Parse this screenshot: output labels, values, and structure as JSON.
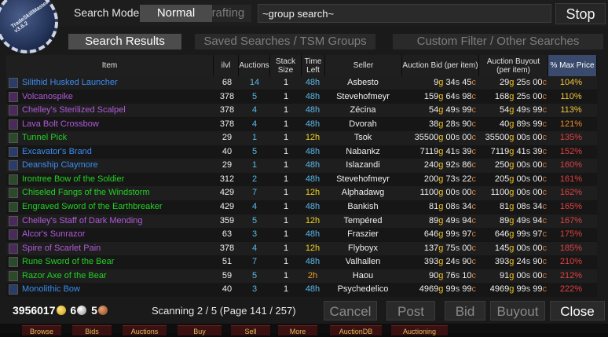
{
  "app": {
    "logo_text": "TradeSkillMaster v3.6.2"
  },
  "search_mode": {
    "label": "Search Mode:",
    "normal": "Normal",
    "crafting": "Crafting"
  },
  "search": {
    "value": "~group search~"
  },
  "stop_label": "Stop",
  "tabs": [
    "Search Results",
    "Saved Searches / TSM Groups",
    "Custom Filter / Other Searches"
  ],
  "columns": {
    "item": "Item",
    "ilvl": "ilvl",
    "auctions": "Auctions",
    "stack": "Stack Size",
    "time": "Time Left",
    "seller": "Seller",
    "bid": "Auction Bid (per item)",
    "buyout": "Auction Buyout (per item)",
    "pct": "% Max Price"
  },
  "colors": {
    "blue": "#3c8cf0",
    "purple": "#b05ad8",
    "green": "#24d024",
    "pct_gold": "#f2c43a",
    "pct_orange": "#f08a2a",
    "pct_red": "#e04040",
    "time_blue": "#5ab8e8",
    "time_yellow": "#f0d020",
    "time_orange": "#f0a020"
  },
  "rows": [
    {
      "name": "Silithid Husked Launcher",
      "quality": "blue",
      "icon": "gun-icon",
      "ilvl": "68",
      "auctions": "14",
      "stack": "1",
      "time": "48h",
      "time_color": "time_blue",
      "seller": "Asbesto",
      "bid": [
        "9",
        "34",
        "45"
      ],
      "buyout": [
        "29",
        "25",
        "00"
      ],
      "pct": "104%",
      "pct_color": "pct_gold"
    },
    {
      "name": "Volcanospike",
      "quality": "purple",
      "icon": "spear-icon",
      "ilvl": "378",
      "auctions": "5",
      "stack": "1",
      "time": "48h",
      "time_color": "time_blue",
      "seller": "Stevehofmeyr",
      "bid": [
        "159",
        "64",
        "98"
      ],
      "buyout": [
        "168",
        "25",
        "00"
      ],
      "pct": "110%",
      "pct_color": "pct_gold"
    },
    {
      "name": "Chelley's Sterilized Scalpel",
      "quality": "purple",
      "icon": "dagger-icon",
      "ilvl": "378",
      "auctions": "4",
      "stack": "1",
      "time": "48h",
      "time_color": "time_blue",
      "seller": "Zécina",
      "bid": [
        "54",
        "49",
        "99"
      ],
      "buyout": [
        "54",
        "49",
        "99"
      ],
      "pct": "113%",
      "pct_color": "pct_gold"
    },
    {
      "name": "Lava Bolt Crossbow",
      "quality": "purple",
      "icon": "crossbow-icon",
      "ilvl": "378",
      "auctions": "4",
      "stack": "1",
      "time": "48h",
      "time_color": "time_blue",
      "seller": "Dvorah",
      "bid": [
        "38",
        "28",
        "90"
      ],
      "buyout": [
        "40",
        "89",
        "99"
      ],
      "pct": "121%",
      "pct_color": "pct_orange"
    },
    {
      "name": "Tunnel Pick",
      "quality": "green",
      "icon": "pick-icon",
      "ilvl": "29",
      "auctions": "1",
      "stack": "1",
      "time": "12h",
      "time_color": "time_yellow",
      "seller": "Tsok",
      "bid": [
        "35500",
        "00",
        "00"
      ],
      "buyout": [
        "35500",
        "00",
        "00"
      ],
      "pct": "135%",
      "pct_color": "pct_red"
    },
    {
      "name": "Excavator's Brand",
      "quality": "blue",
      "icon": "sword-icon",
      "ilvl": "40",
      "auctions": "5",
      "stack": "1",
      "time": "48h",
      "time_color": "time_blue",
      "seller": "Nabankz",
      "bid": [
        "7119",
        "41",
        "39"
      ],
      "buyout": [
        "7119",
        "41",
        "39"
      ],
      "pct": "152%",
      "pct_color": "pct_red"
    },
    {
      "name": "Deanship Claymore",
      "quality": "blue",
      "icon": "claymore-icon",
      "ilvl": "29",
      "auctions": "1",
      "stack": "1",
      "time": "48h",
      "time_color": "time_blue",
      "seller": "Islazandi",
      "bid": [
        "240",
        "92",
        "86"
      ],
      "buyout": [
        "250",
        "00",
        "00"
      ],
      "pct": "160%",
      "pct_color": "pct_red"
    },
    {
      "name": "Irontree Bow of the Soldier",
      "quality": "green",
      "icon": "bow-icon",
      "ilvl": "312",
      "auctions": "2",
      "stack": "1",
      "time": "48h",
      "time_color": "time_blue",
      "seller": "Stevehofmeyr",
      "bid": [
        "200",
        "73",
        "22"
      ],
      "buyout": [
        "205",
        "00",
        "00"
      ],
      "pct": "161%",
      "pct_color": "pct_red"
    },
    {
      "name": "Chiseled Fangs of the Windstorm",
      "quality": "green",
      "icon": "fist-icon",
      "ilvl": "429",
      "auctions": "7",
      "stack": "1",
      "time": "12h",
      "time_color": "time_yellow",
      "seller": "Alphadawg",
      "bid": [
        "1100",
        "00",
        "00"
      ],
      "buyout": [
        "1100",
        "00",
        "00"
      ],
      "pct": "162%",
      "pct_color": "pct_red"
    },
    {
      "name": "Engraved Sword of the Earthbreaker",
      "quality": "green",
      "icon": "sword-icon",
      "ilvl": "429",
      "auctions": "4",
      "stack": "1",
      "time": "48h",
      "time_color": "time_blue",
      "seller": "Bankish",
      "bid": [
        "81",
        "08",
        "34"
      ],
      "buyout": [
        "81",
        "08",
        "34"
      ],
      "pct": "165%",
      "pct_color": "pct_red"
    },
    {
      "name": "Chelley's Staff of Dark Mending",
      "quality": "purple",
      "icon": "staff-icon",
      "ilvl": "359",
      "auctions": "5",
      "stack": "1",
      "time": "12h",
      "time_color": "time_yellow",
      "seller": "Tempéred",
      "bid": [
        "89",
        "49",
        "94"
      ],
      "buyout": [
        "89",
        "49",
        "94"
      ],
      "pct": "167%",
      "pct_color": "pct_red"
    },
    {
      "name": "Alcor's Sunrazor",
      "quality": "purple",
      "icon": "dagger-icon",
      "ilvl": "63",
      "auctions": "3",
      "stack": "1",
      "time": "48h",
      "time_color": "time_blue",
      "seller": "Fraszier",
      "bid": [
        "646",
        "99",
        "97"
      ],
      "buyout": [
        "646",
        "99",
        "97"
      ],
      "pct": "175%",
      "pct_color": "pct_red"
    },
    {
      "name": "Spire of Scarlet Pain",
      "quality": "purple",
      "icon": "spear-icon",
      "ilvl": "378",
      "auctions": "4",
      "stack": "1",
      "time": "12h",
      "time_color": "time_yellow",
      "seller": "Flyboyx",
      "bid": [
        "137",
        "75",
        "00"
      ],
      "buyout": [
        "145",
        "00",
        "00"
      ],
      "pct": "185%",
      "pct_color": "pct_red"
    },
    {
      "name": "Rune Sword of the Bear",
      "quality": "green",
      "icon": "sword-icon",
      "ilvl": "51",
      "auctions": "7",
      "stack": "1",
      "time": "48h",
      "time_color": "time_blue",
      "seller": "Valhallen",
      "bid": [
        "393",
        "24",
        "90"
      ],
      "buyout": [
        "393",
        "24",
        "90"
      ],
      "pct": "210%",
      "pct_color": "pct_red"
    },
    {
      "name": "Razor Axe of the Bear",
      "quality": "green",
      "icon": "axe-icon",
      "ilvl": "59",
      "auctions": "5",
      "stack": "1",
      "time": "2h",
      "time_color": "time_orange",
      "seller": "Haou",
      "bid": [
        "90",
        "76",
        "10"
      ],
      "buyout": [
        "91",
        "00",
        "00"
      ],
      "pct": "212%",
      "pct_color": "pct_red"
    },
    {
      "name": "Monolithic Bow",
      "quality": "blue",
      "icon": "bow-icon",
      "ilvl": "40",
      "auctions": "3",
      "stack": "1",
      "time": "48h",
      "time_color": "time_blue",
      "seller": "Psychedelico",
      "bid": [
        "4969",
        "99",
        "99"
      ],
      "buyout": [
        "4969",
        "99",
        "99"
      ],
      "pct": "222%",
      "pct_color": "pct_red"
    }
  ],
  "money": {
    "gold": "3956017",
    "silver": "6",
    "copper": "5"
  },
  "status": "Scanning 2 / 5 (Page 141 / 257)",
  "buttons": {
    "cancel": "Cancel",
    "post": "Post",
    "bid": "Bid",
    "buyout": "Buyout",
    "close": "Close"
  },
  "bottom_tabs": [
    "Browse",
    "Bids",
    "Auctions",
    "Buy",
    "Sell",
    "More",
    "AuctionDB",
    "Auctioning"
  ]
}
